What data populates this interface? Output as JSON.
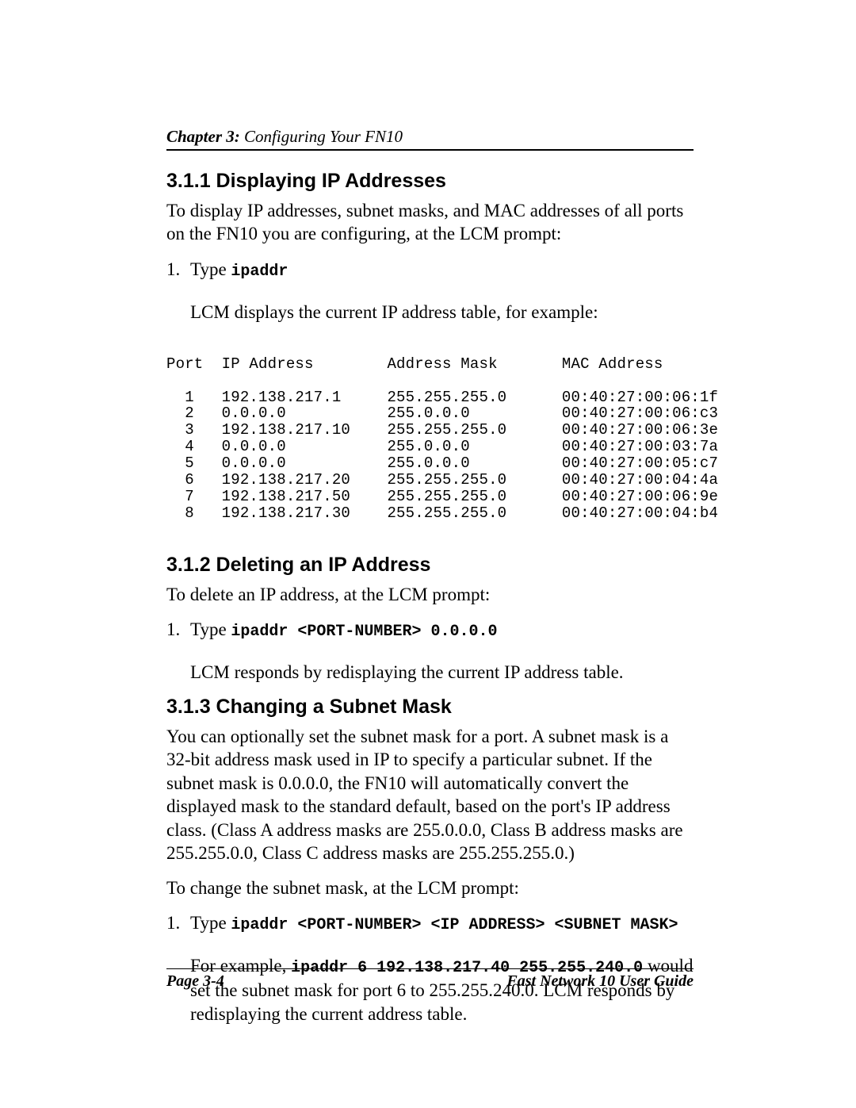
{
  "header": {
    "chapter": "Chapter 3:",
    "title": " Configuring Your FN10"
  },
  "s311": {
    "heading": "3.1.1  Displaying IP Addresses",
    "intro": "To display IP addresses, subnet masks, and MAC addresses of all ports on the FN10 you are configuring, at the LCM prompt:",
    "step_num": "1.",
    "step_type": "Type ",
    "step_cmd": "ipaddr",
    "after": "LCM displays the current IP address table, for example:",
    "table_header": "Port  IP Address        Address Mask       MAC Address",
    "rows": [
      [
        "1",
        "192.138.217.1",
        "255.255.255.0",
        "00:40:27:00:06:1f"
      ],
      [
        "2",
        "0.0.0.0",
        "255.0.0.0",
        "00:40:27:00:06:c3"
      ],
      [
        "3",
        "192.138.217.10",
        "255.255.255.0",
        "00:40:27:00:06:3e"
      ],
      [
        "4",
        "0.0.0.0",
        "255.0.0.0",
        "00:40:27:00:03:7a"
      ],
      [
        "5",
        "0.0.0.0",
        "255.0.0.0",
        "00:40:27:00:05:c7"
      ],
      [
        "6",
        "192.138.217.20",
        "255.255.255.0",
        "00:40:27:00:04:4a"
      ],
      [
        "7",
        "192.138.217.50",
        "255.255.255.0",
        "00:40:27:00:06:9e"
      ],
      [
        "8",
        "192.138.217.30",
        "255.255.255.0",
        "00:40:27:00:04:b4"
      ]
    ]
  },
  "s312": {
    "heading": "3.1.2  Deleting an IP Address",
    "intro": "To delete an IP address, at the LCM prompt:",
    "step_num": "1.",
    "step_type": "Type ",
    "step_cmd": "ipaddr <PORT-NUMBER> 0.0.0.0",
    "after": "LCM responds by redisplaying the current IP address table."
  },
  "s313": {
    "heading": "3.1.3  Changing a Subnet Mask",
    "para": "You can optionally set the subnet mask for a port. A subnet mask is a 32-bit address mask used in IP to specify a particular subnet. If the subnet mask is 0.0.0.0, the FN10 will automatically convert the displayed mask to the standard default, based on the port's IP address class. (Class A address masks are 255.0.0.0, Class B address masks are 255.255.0.0, Class C address masks are 255.255.255.0.)",
    "intro": "To change the subnet mask, at the LCM prompt:",
    "step_num": "1.",
    "step_type": "Type ",
    "step_cmd": "ipaddr <PORT-NUMBER> <IP ADDRESS> <SUBNET MASK>",
    "after_pre": "For example, ",
    "after_cmd": "ipaddr 6 192.138.217.40 255.255.240.0",
    "after_post": " would set the subnet mask for port 6 to 255.255.240.0. LCM responds by redisplaying the current address table."
  },
  "footer": {
    "left": "Page 3-4",
    "right": "Fast Network 10 User Guide"
  }
}
